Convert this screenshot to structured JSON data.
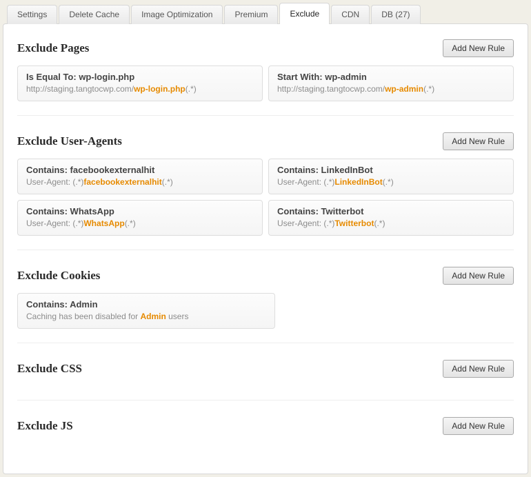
{
  "tabs": [
    {
      "label": "Settings",
      "active": false
    },
    {
      "label": "Delete Cache",
      "active": false
    },
    {
      "label": "Image Optimization",
      "active": false
    },
    {
      "label": "Premium",
      "active": false
    },
    {
      "label": "Exclude",
      "active": true
    },
    {
      "label": "CDN",
      "active": false
    },
    {
      "label": "DB (27)",
      "active": false
    }
  ],
  "add_label": "Add New Rule",
  "sections": [
    {
      "title": "Exclude Pages",
      "single": false,
      "rules": [
        {
          "title": "Is Equal To: wp-login.php",
          "pre": "http://staging.tangtocwp.com/",
          "hl": "wp-login.php",
          "post": "(.*)"
        },
        {
          "title": "Start With: wp-admin",
          "pre": "http://staging.tangtocwp.com/",
          "hl": "wp-admin",
          "post": "(.*)"
        }
      ]
    },
    {
      "title": "Exclude User-Agents",
      "single": false,
      "rules": [
        {
          "title": "Contains: facebookexternalhit",
          "pre": "User-Agent: (.*)",
          "hl": "facebookexternalhit",
          "post": "(.*)"
        },
        {
          "title": "Contains: LinkedInBot",
          "pre": "User-Agent: (.*)",
          "hl": "LinkedInBot",
          "post": "(.*)"
        },
        {
          "title": "Contains: WhatsApp",
          "pre": "User-Agent: (.*)",
          "hl": "WhatsApp",
          "post": "(.*)"
        },
        {
          "title": "Contains: Twitterbot",
          "pre": "User-Agent: (.*)",
          "hl": "Twitterbot",
          "post": "(.*)"
        }
      ]
    },
    {
      "title": "Exclude Cookies",
      "single": true,
      "rules": [
        {
          "title": "Contains: Admin",
          "pre": "Caching has been disabled for ",
          "hl": "Admin",
          "post": " users"
        }
      ]
    },
    {
      "title": "Exclude CSS",
      "single": false,
      "rules": []
    },
    {
      "title": "Exclude JS",
      "single": false,
      "rules": []
    }
  ]
}
